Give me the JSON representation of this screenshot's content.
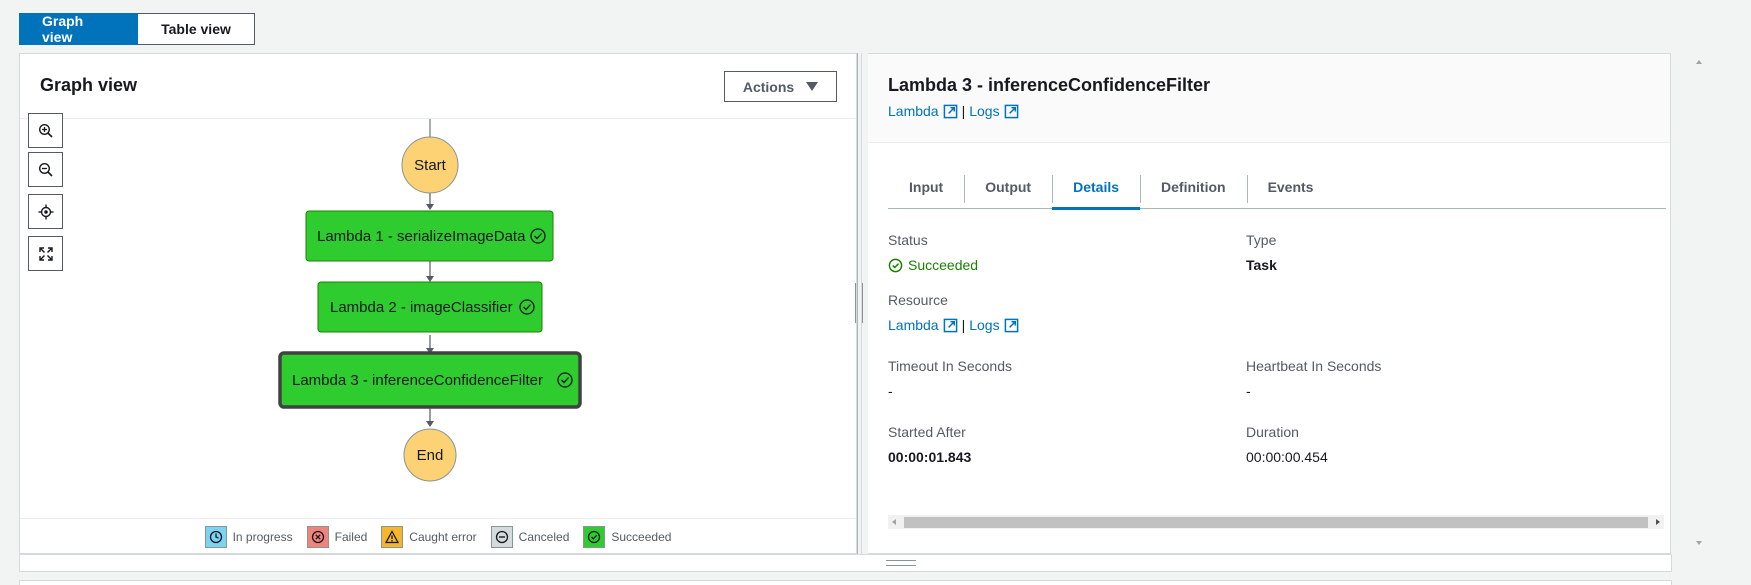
{
  "view_toggle": {
    "graph_label": "Graph view",
    "table_label": "Table view"
  },
  "left_panel": {
    "title": "Graph view",
    "actions_label": "Actions",
    "zoom_controls": [
      "zoom-in-icon",
      "zoom-out-icon",
      "center-icon",
      "fit-icon"
    ]
  },
  "graph": {
    "start_label": "Start",
    "end_label": "End",
    "nodes": [
      "Lambda 1 - serializeImageData",
      "Lambda 2 - imageClassifier",
      "Lambda 3 - inferenceConfidenceFilter"
    ],
    "selected_node": 3,
    "colors": {
      "succeeded": "#2ecc2e",
      "terminal": "#fcd275",
      "selected_border": "#414141"
    }
  },
  "legend": {
    "in_progress": "In progress",
    "failed": "Failed",
    "caught_error": "Caught error",
    "canceled": "Canceled",
    "succeeded": "Succeeded"
  },
  "right_panel": {
    "title": "Lambda 3 - inferenceConfidenceFilter",
    "lambda_link": "Lambda",
    "separator": "|",
    "logs_link": "Logs",
    "tabs": [
      "Input",
      "Output",
      "Details",
      "Definition",
      "Events"
    ],
    "active_tab": "Details",
    "details": {
      "status_label": "Status",
      "status_value": "Succeeded",
      "type_label": "Type",
      "type_value": "Task",
      "resource_label": "Resource",
      "resource_lambda": "Lambda",
      "resource_logs": "Logs",
      "timeout_label": "Timeout In Seconds",
      "timeout_value": "-",
      "heartbeat_label": "Heartbeat In Seconds",
      "heartbeat_value": "-",
      "started_after_label": "Started After",
      "started_after_value": "00:00:01.843",
      "duration_label": "Duration",
      "duration_value": "00:00:00.454"
    }
  }
}
